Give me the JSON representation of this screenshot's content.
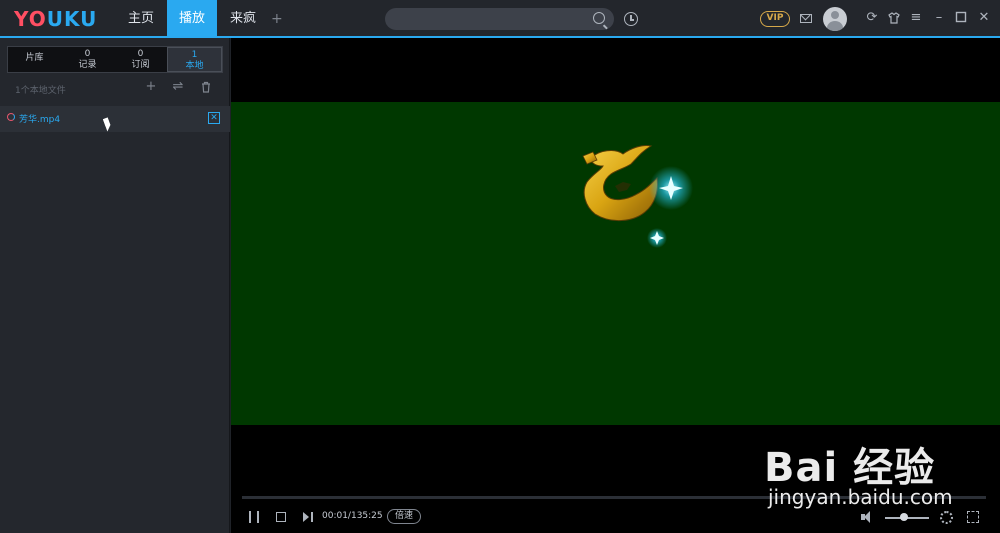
{
  "app": {
    "logo_left": "YO",
    "logo_right": "UKU",
    "brand_colors": {
      "accent": "#2aa9f0",
      "logo_red": "#ff4f63"
    }
  },
  "nav": {
    "tabs": [
      {
        "label": "主页",
        "active": false
      },
      {
        "label": "播放",
        "active": true
      },
      {
        "label": "来疯",
        "active": false
      }
    ],
    "plus": "+"
  },
  "header": {
    "search_placeholder": "",
    "vip_label": "VIP",
    "icons": [
      "search-icon",
      "history-icon",
      "mail-icon",
      "avatar",
      "refresh-icon",
      "skin-icon",
      "menu-icon",
      "minimize-icon",
      "maximize-icon",
      "close-icon"
    ]
  },
  "sidebar": {
    "stats": [
      {
        "count": "",
        "label": "片库",
        "active": false
      },
      {
        "count": "0",
        "label": "记录",
        "active": false
      },
      {
        "count": "0",
        "label": "订阅",
        "active": false
      },
      {
        "count": "1",
        "label": "本地",
        "active": true
      }
    ],
    "local_count_text": "1个本地文件",
    "files": [
      {
        "name": "芳华.mp4"
      }
    ]
  },
  "player": {
    "time": "00:01/135:25",
    "speed_label": "倍速",
    "volume_level": 0.4,
    "progress": 0.0
  },
  "watermark": {
    "main": "Bai 经验",
    "sub": "jingyan.baidu.com"
  }
}
